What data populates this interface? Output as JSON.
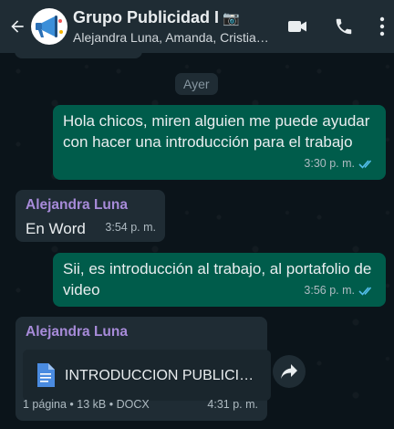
{
  "header": {
    "title": "Grupo Publicidad I",
    "title_emoji": "📷",
    "subtitle": "Alejandra Luna, Amanda, Cristia…",
    "icons": [
      "back-arrow-icon",
      "video-call-icon",
      "phone-icon",
      "more-vert-icon"
    ]
  },
  "day_label": "Ayer",
  "messages": [
    {
      "direction": "outgoing",
      "text": "Hola chicos, miren alguien me puede ayudar con hacer una introducción para el trabajo",
      "time": "3:30 p. m.",
      "status": "read"
    },
    {
      "direction": "incoming",
      "sender": "Alejandra Luna",
      "text": "En Word",
      "time": "3:54 p. m."
    },
    {
      "direction": "outgoing",
      "text": "Sii, es introducción al trabajo, al portafolio de video",
      "time": "3:56 p. m.",
      "status": "read"
    },
    {
      "direction": "incoming",
      "sender": "Alejandra Luna",
      "type": "document",
      "file_name": "INTRODUCCION PUBLICI…",
      "file_info": "1 página • 13 kB • DOCX",
      "time": "4:31 p. m."
    }
  ],
  "colors": {
    "header_bg": "#1f2c34",
    "chat_bg": "#0b141a",
    "outgoing_bubble": "#005c4b",
    "incoming_bubble": "#1f2c34",
    "sender_name": "#a78bd9",
    "read_ticks": "#53bdeb"
  }
}
